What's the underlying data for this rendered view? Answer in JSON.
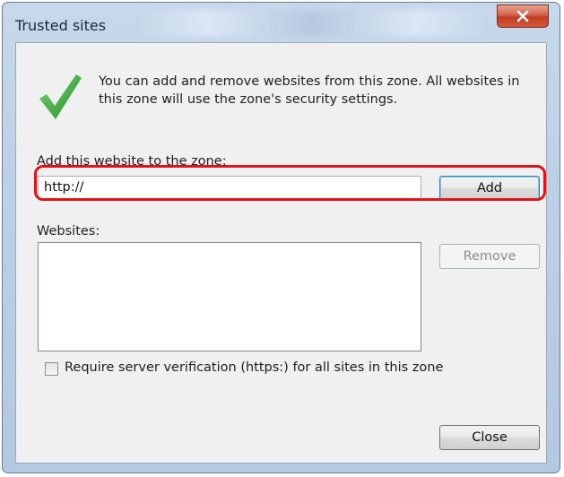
{
  "window": {
    "title": "Trusted sites"
  },
  "header": {
    "description": "You can add and remove websites from this zone. All websites in this zone will use the zone's security settings.",
    "icon": "checkmark-icon"
  },
  "add_section": {
    "label": "Add this website to the zone:",
    "input_value": "http://",
    "add_label": "Add"
  },
  "websites_section": {
    "label": "Websites:",
    "items": [],
    "remove_label": "Remove"
  },
  "require_verification": {
    "label": "Require server verification (https:) for all sites in this zone",
    "checked": false
  },
  "footer": {
    "close_label": "Close"
  },
  "colors": {
    "highlight": "#e0121b",
    "check": "#39b54a",
    "close_button": "#c9442b"
  }
}
